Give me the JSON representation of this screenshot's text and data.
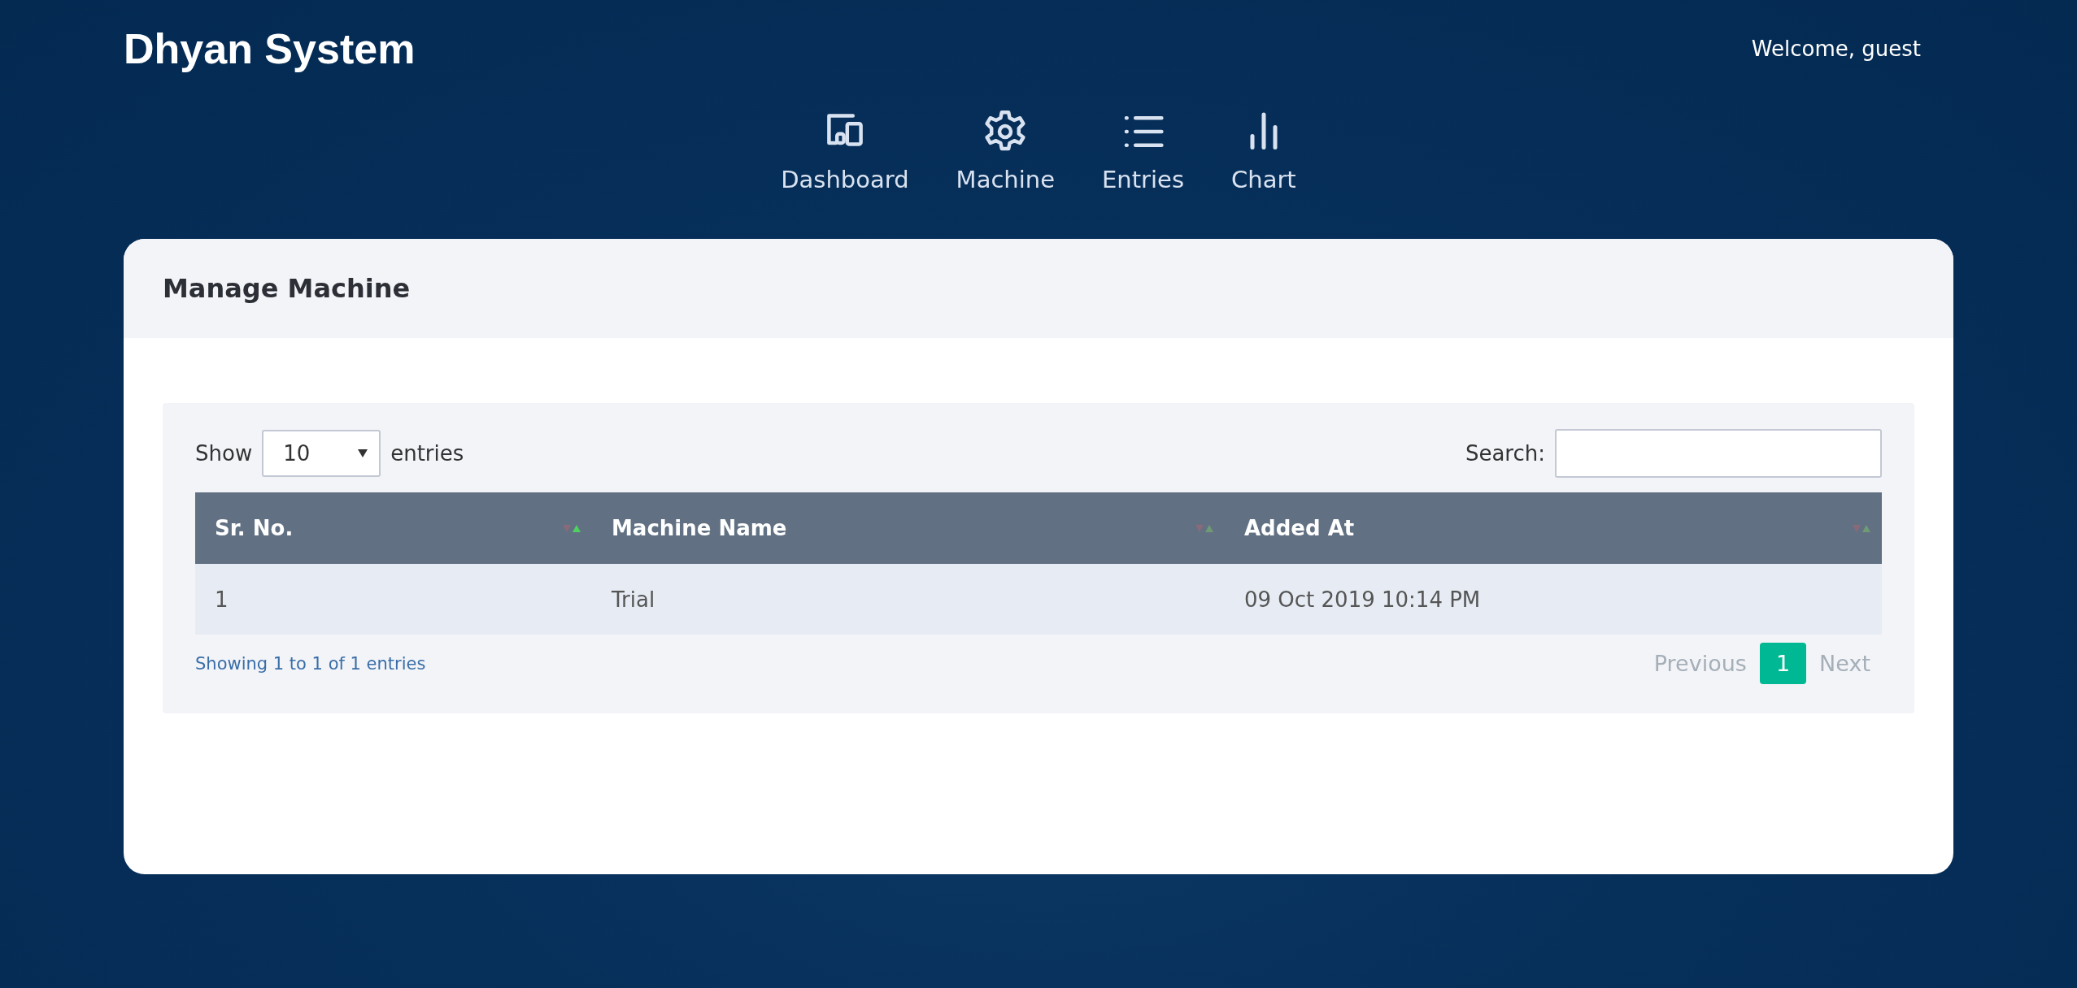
{
  "brand": "Dhyan System",
  "welcome": "Welcome, guest",
  "nav": [
    {
      "label": "Dashboard"
    },
    {
      "label": "Machine"
    },
    {
      "label": "Entries"
    },
    {
      "label": "Chart"
    }
  ],
  "card": {
    "title": "Manage Machine"
  },
  "length": {
    "before": "Show",
    "value": "10",
    "after": "entries"
  },
  "search": {
    "label": "Search:"
  },
  "table": {
    "columns": [
      {
        "label": "Sr. No.",
        "sorted": true
      },
      {
        "label": "Machine Name",
        "sorted": false
      },
      {
        "label": "Added At",
        "sorted": false
      }
    ],
    "rows": [
      [
        "1",
        "Trial",
        "09 Oct 2019 10:14 PM"
      ]
    ]
  },
  "info": "Showing 1 to 1 of 1 entries",
  "pagination": [
    {
      "label": "Previous",
      "kind": "prev",
      "disabled": true,
      "selected": false
    },
    {
      "label": "1",
      "kind": "page",
      "disabled": false,
      "selected": true
    },
    {
      "label": "Next",
      "kind": "next",
      "disabled": true,
      "selected": false
    }
  ]
}
